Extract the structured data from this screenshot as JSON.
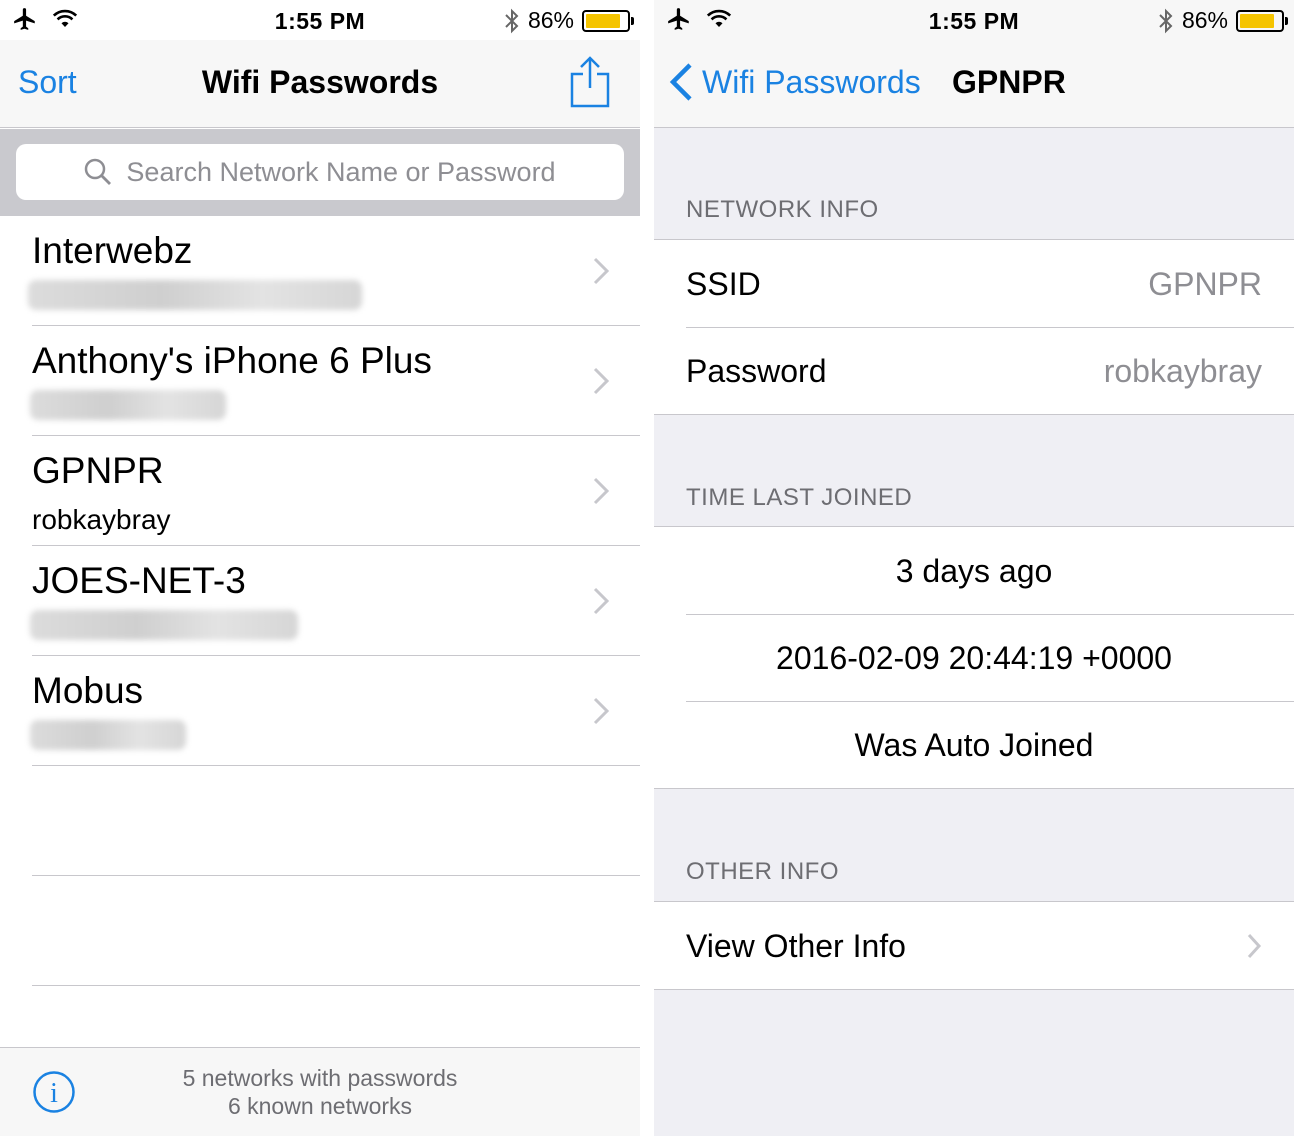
{
  "status_bar": {
    "time": "1:55 PM",
    "battery": "86%",
    "battery_level": 0.86
  },
  "list_screen": {
    "nav": {
      "left_button": "Sort",
      "title": "Wifi Passwords",
      "right_icon": "share-icon"
    },
    "search": {
      "placeholder": "Search Network Name or Password"
    },
    "networks": [
      {
        "name": "Interwebz",
        "password": "",
        "password_redacted": true
      },
      {
        "name": "Anthony's iPhone 6 Plus",
        "password": "",
        "password_redacted": true
      },
      {
        "name": "GPNPR",
        "password": "robkaybray",
        "password_redacted": false
      },
      {
        "name": "JOES-NET-3",
        "password": "",
        "password_redacted": true
      },
      {
        "name": "Mobus",
        "password": "",
        "password_redacted": true
      }
    ],
    "toolbar": {
      "line1": "5 networks with passwords",
      "line2": "6 known networks",
      "icon": "info-icon"
    }
  },
  "detail_screen": {
    "nav": {
      "back_label": "Wifi Passwords",
      "title": "GPNPR"
    },
    "network_info": {
      "header": "NETWORK INFO",
      "ssid_label": "SSID",
      "ssid_value": "GPNPR",
      "password_label": "Password",
      "password_value": "robkaybray"
    },
    "time_last_joined": {
      "header": "TIME LAST JOINED",
      "relative": "3 days ago",
      "timestamp": "2016-02-09 20:44:19 +0000",
      "auto_joined": "Was Auto Joined"
    },
    "other_info": {
      "header": "OTHER INFO",
      "view_label": "View Other Info"
    }
  },
  "colors": {
    "accent": "#1a82e2",
    "battery": "#f5c400",
    "secondary_text": "#8e8e93",
    "grouped_bg": "#efeff4"
  }
}
